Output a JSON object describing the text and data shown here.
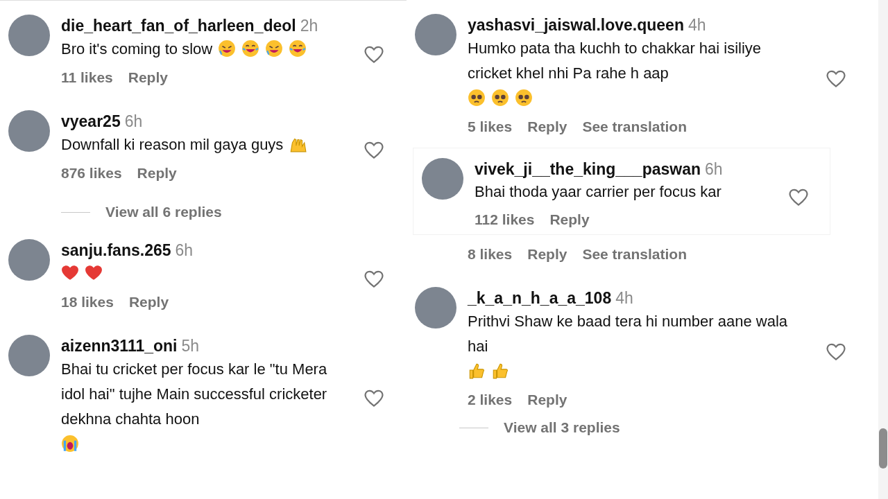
{
  "left_panel": {
    "items": [
      {
        "kind": "comment",
        "username": "die_heart_fan_of_harleen_deol",
        "time": "2h",
        "text": "Bro it's coming to slow",
        "emoji": [
          {
            "kind": "rofl"
          },
          {
            "kind": "joy"
          },
          {
            "kind": "rofl"
          },
          {
            "kind": "joy"
          }
        ],
        "likes": "11 likes",
        "reply": "Reply"
      },
      {
        "kind": "comment",
        "username": "vyear25",
        "time": "6h",
        "text": "Downfall ki reason mil gaya guys",
        "emoji": [
          {
            "kind": "raised-hands"
          }
        ],
        "likes": "876 likes",
        "reply": "Reply"
      },
      {
        "kind": "view_replies",
        "label": "View all 6 replies"
      },
      {
        "kind": "comment",
        "username": "sanju.fans.265",
        "time": "6h",
        "emoji": [
          {
            "kind": "red-heart"
          },
          {
            "kind": "red-heart"
          }
        ],
        "likes": "18 likes",
        "reply": "Reply"
      },
      {
        "kind": "comment",
        "username": "aizenn3111_oni",
        "time": "5h",
        "text": "Bhai tu cricket per focus kar le \"tu Mera idol hai\" tujhe Main successful cricketer dekhna chahta hoon",
        "emoji": [
          {
            "kind": "crying"
          }
        ]
      }
    ]
  },
  "right_panel": {
    "items": [
      {
        "kind": "comment",
        "username": "yashasvi_jaiswal.love.queen",
        "time": "4h",
        "text": "Humko pata tha kuchh to chakkar hai isiliye cricket khel nhi Pa rahe h aap",
        "emoji": [
          {
            "kind": "pleading"
          },
          {
            "kind": "pleading"
          },
          {
            "kind": "pleading"
          }
        ],
        "likes": "5 likes",
        "reply": "Reply",
        "see_translation": "See translation"
      },
      {
        "kind": "overlay",
        "username": "vivek_ji__the_king___paswan",
        "time": "6h",
        "text": "Bhai thoda yaar carrier per focus kar",
        "likes": "112 likes",
        "reply": "Reply"
      },
      {
        "kind": "actions",
        "likes": "8 likes",
        "reply": "Reply",
        "see_translation": "See translation"
      },
      {
        "kind": "comment",
        "username": "_k_a_n_h_a_a_108",
        "time": "4h",
        "text": "Prithvi Shaw ke baad tera hi number aane wala hai",
        "emoji": [
          {
            "kind": "thumbs-up"
          },
          {
            "kind": "thumbs-up"
          }
        ],
        "likes": "2 likes",
        "reply": "Reply"
      },
      {
        "kind": "view_replies",
        "label": "View all 3 replies"
      }
    ]
  }
}
